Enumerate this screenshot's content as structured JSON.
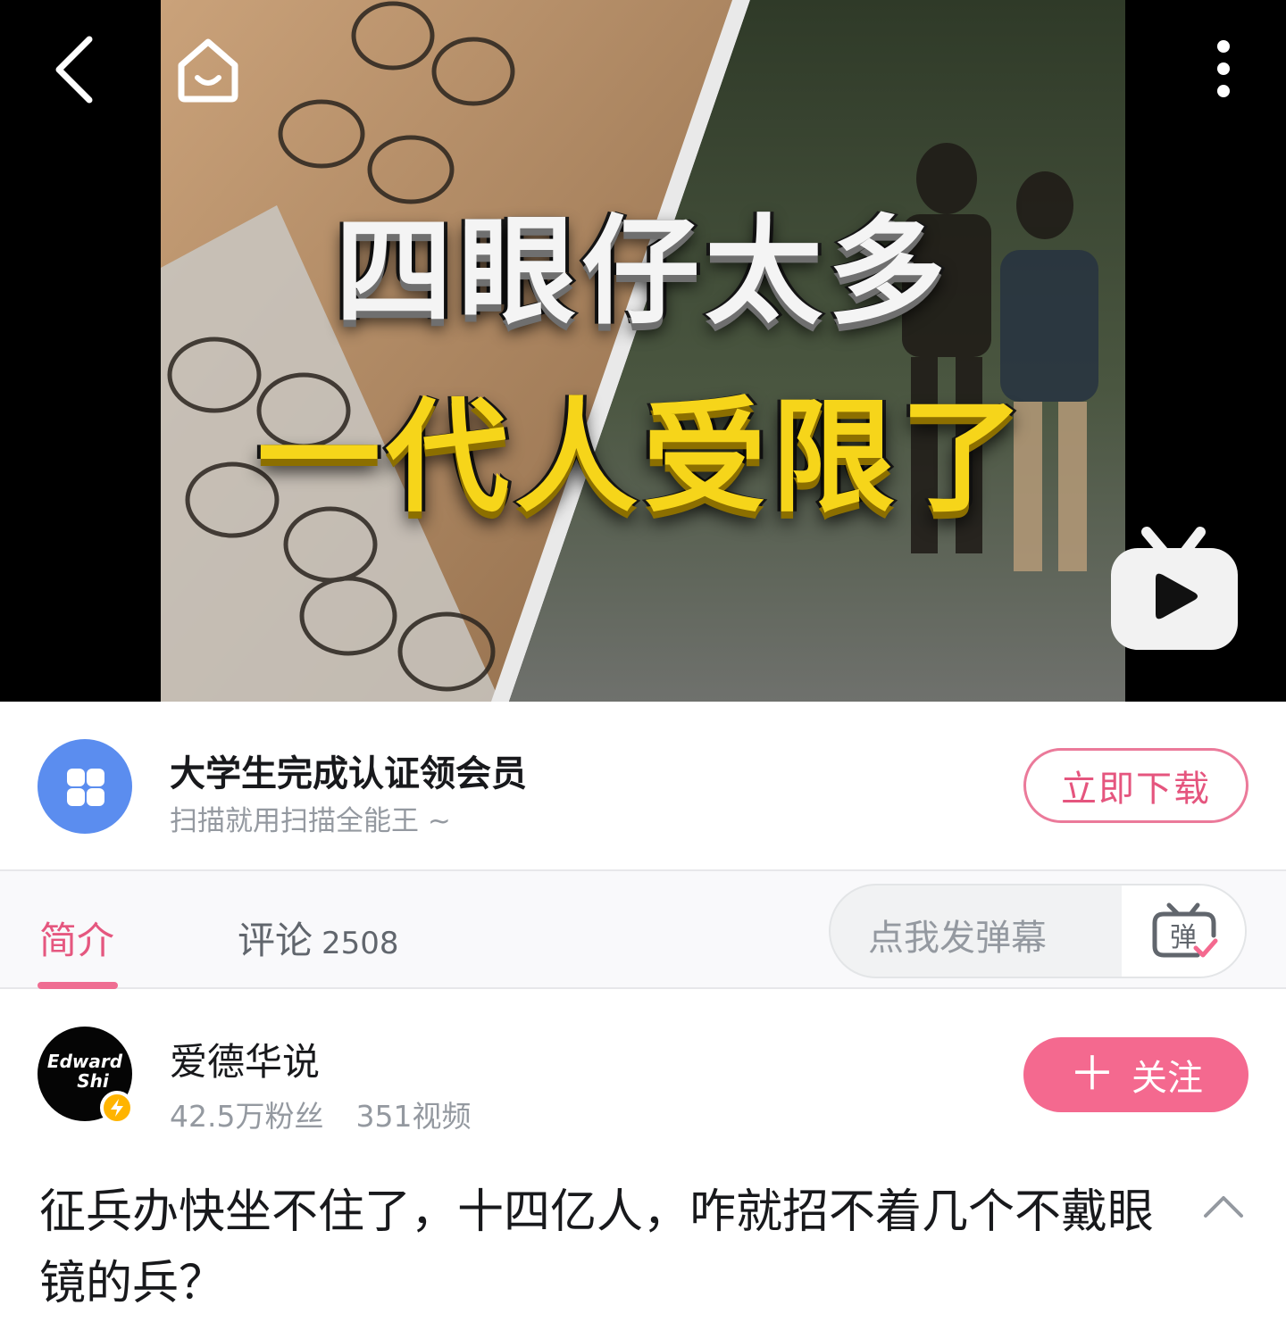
{
  "video": {
    "headline_line1": "四眼仔太多",
    "headline_line2": "一代人受限了",
    "icons": {
      "back": "chevron-left-icon",
      "home": "home-face-icon",
      "more": "more-vertical-icon",
      "play": "tv-play-icon"
    }
  },
  "ad": {
    "title": "大学生完成认证领会员",
    "subtitle": "扫描就用扫描全能王 ~",
    "download_label": "立即下载"
  },
  "tabs": {
    "intro_label": "简介",
    "comments_label": "评论",
    "comments_count": "2508",
    "danmaku_placeholder": "点我发弹幕",
    "danmaku_icon_char": "弹"
  },
  "uploader": {
    "avatar_text_line1": "Edward",
    "avatar_text_line2": "Shi",
    "name": "爱德华说",
    "followers": "42.5万粉丝",
    "videos": "351视频",
    "follow_plus": "＋",
    "follow_label": "关注"
  },
  "title": {
    "text": "征兵办快坐不住了，十四亿人，咋就招不着几个不戴眼镜的兵？"
  },
  "colors": {
    "accent_pink": "#f4698f",
    "tab_active": "#e5577f",
    "headline_yellow": "#f6d51a",
    "ad_logo_blue": "#5b8def",
    "verified_yellow": "#ffb400"
  }
}
